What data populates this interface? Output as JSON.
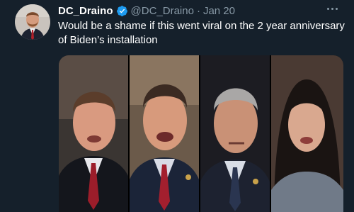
{
  "tweet": {
    "display_name": "DC_Draino",
    "handle": "@DC_Draino",
    "separator": "·",
    "date": "Jan 20",
    "text": "Would be a shame if this went viral on the 2 year anniversary of Biden’s installation"
  },
  "icons": {
    "verified": "verified-badge-icon",
    "more": "more-options-icon"
  },
  "colors": {
    "background": "#15202b",
    "secondary_text": "#8899a6",
    "verified_blue": "#1d9bf0"
  },
  "media": {
    "panels": [
      {
        "name": "man-in-suit-red-tie-photo"
      },
      {
        "name": "man-in-suit-red-tie-speaking-photo"
      },
      {
        "name": "gray-haired-man-dark-tie-photo"
      },
      {
        "name": "woman-dark-hair-photo"
      }
    ]
  }
}
